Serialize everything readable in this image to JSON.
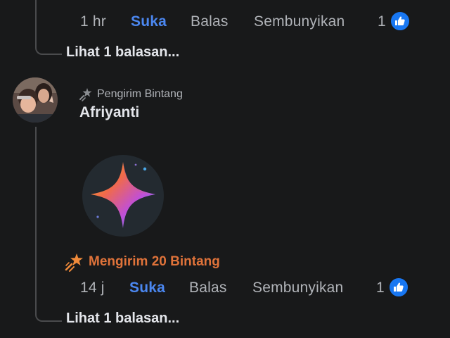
{
  "comments": [
    {
      "time": "1 hr",
      "like_label": "Suka",
      "reply_label": "Balas",
      "hide_label": "Sembunyikan",
      "reaction_count": "1",
      "reaction_icon": "like-icon",
      "replies_link": "Lihat 1 balasan..."
    },
    {
      "avatar_icon": "user-avatar-photo",
      "badge_icon": "star-sender-icon",
      "badge_label": "Pengirim Bintang",
      "author": "Afriyanti",
      "sticker_icon": "sparkle-star-sticker",
      "sent_icon": "shooting-star-icon",
      "sent_label": "Mengirim 20 Bintang",
      "time": "14 j",
      "like_label": "Suka",
      "reply_label": "Balas",
      "hide_label": "Sembunyikan",
      "reaction_count": "1",
      "reaction_icon": "like-icon",
      "replies_link": "Lihat 1 balasan..."
    }
  ],
  "colors": {
    "background": "#18191a",
    "like_blue": "#4b87f0",
    "muted_text": "#b0b3b8",
    "primary_text": "#e4e6eb",
    "stars_orange": "#e0733a"
  }
}
